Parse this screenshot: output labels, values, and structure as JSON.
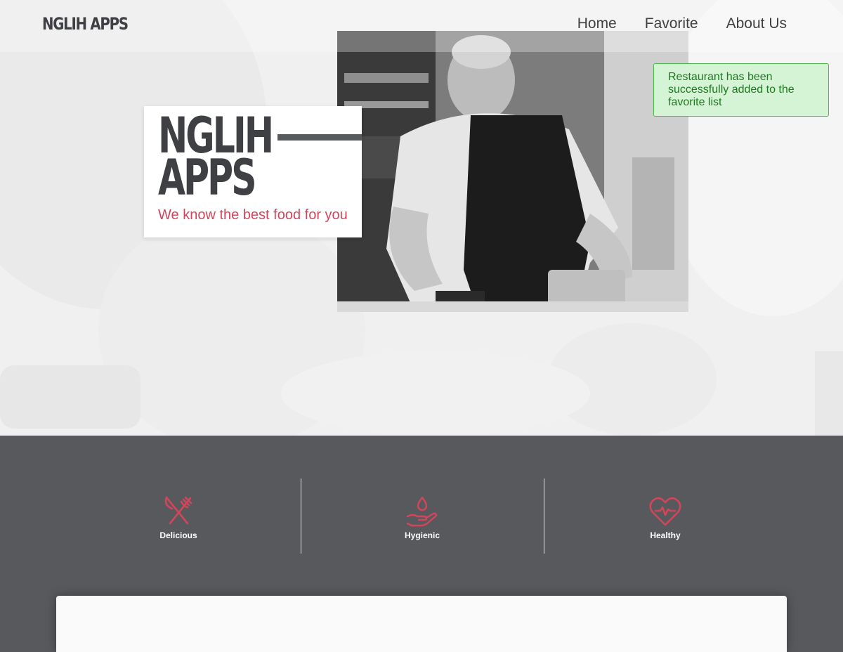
{
  "header": {
    "brand": "NGLIH APPS",
    "nav": [
      {
        "label": "Home"
      },
      {
        "label": "Favorite"
      },
      {
        "label": "About Us"
      }
    ]
  },
  "hero": {
    "title": "NGLIH APPS",
    "tagline": "We know the best food for you"
  },
  "toast": {
    "message": "Restaurant has been successfully added to the favorite list"
  },
  "features": [
    {
      "label": "Delicious",
      "icon": "fork-knife-icon"
    },
    {
      "label": "Hygienic",
      "icon": "hand-water-drop-icon"
    },
    {
      "label": "Healthy",
      "icon": "heart-pulse-icon"
    }
  ],
  "colors": {
    "accent": "#d3455b",
    "dark": "#3f4043",
    "band": "#58595d",
    "toast_bg": "#d5f3d5",
    "toast_text": "#1f7a1f"
  }
}
